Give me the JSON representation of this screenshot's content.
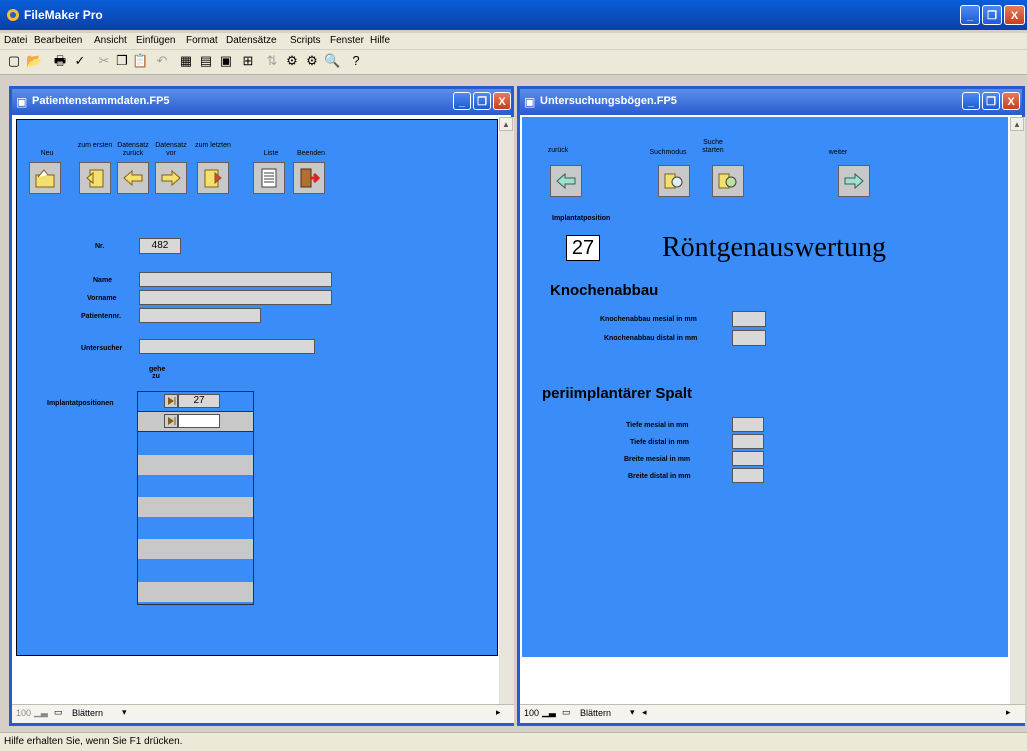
{
  "app": {
    "title": "FileMaker Pro",
    "window_buttons": {
      "minimize": "_",
      "maximize": "❐",
      "close": "X"
    }
  },
  "menu": [
    "Datei",
    "Bearbeiten",
    "Ansicht",
    "Einfügen",
    "Format",
    "Datensätze",
    "Scripts",
    "Fenster",
    "Hilfe"
  ],
  "status_text": "Hilfe erhalten Sie, wenn Sie F1 drücken.",
  "left_window": {
    "title": "Patientenstammdaten.FP5",
    "nav_labels": {
      "neu": "Neu",
      "zum_ersten": "zum ersten",
      "datensatz_zurueck": "Datensatz zurück",
      "datensatz_vor": "Datensatz vor",
      "zum_letzten": "zum letzten",
      "liste": "Liste",
      "beenden": "Beenden"
    },
    "nr_label": "Nr.",
    "nr_value": "482",
    "name_label": "Name",
    "vorname_label": "Vorname",
    "patientennr_label": "Patientennr.",
    "untersucher_label": "Untersucher",
    "gehe_zu_label": "gehe zu",
    "implantat_label": "Implantatpositionen",
    "implantat_rows": [
      "27",
      ""
    ],
    "zoom": "100",
    "mode": "Blättern"
  },
  "right_window": {
    "title": "Untersuchungsbögen.FP5",
    "nav_labels": {
      "zurueck": "zurück",
      "suchmodus": "Suchmodus",
      "suche_starten": "Suche starten",
      "weiter": "weiter"
    },
    "implantatposition_label": "Implantatposition",
    "implantatposition_value": "27",
    "heading": "Röntgenauswertung",
    "knochenabbau_heading": "Knochenabbau",
    "knochen_mesial": "Knochenabbau mesial in mm",
    "knochen_distal": "Knochenabbau distal in mm",
    "spalt_heading": "periimplantärer Spalt",
    "tiefe_mesial": "Tiefe mesial in mm",
    "tiefe_distal": "Tiefe distal in mm",
    "breite_mesial": "Breite mesial in mm",
    "breite_distal": "Breite distal in mm",
    "zoom": "100",
    "mode": "Blättern"
  },
  "colors": {
    "layout_bg": "#3a8cf8",
    "title_bar": "#0b3fa8"
  }
}
